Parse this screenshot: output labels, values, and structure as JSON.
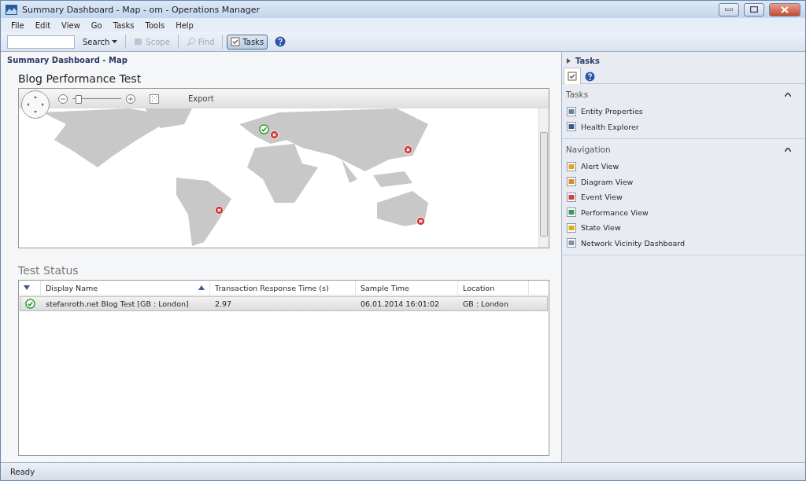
{
  "window": {
    "title": "Summary Dashboard - Map - om - Operations Manager"
  },
  "menu": [
    "File",
    "Edit",
    "View",
    "Go",
    "Tasks",
    "Tools",
    "Help"
  ],
  "toolbar": {
    "search_button": "Search",
    "scope": {
      "label": "Scope",
      "disabled": true
    },
    "find": {
      "label": "Find",
      "disabled": true
    },
    "tasks": {
      "label": "Tasks",
      "selected": true
    }
  },
  "breadcrumb": "Summary Dashboard - Map",
  "map_section": {
    "title": "Blog Performance Test",
    "zoom": {
      "level": 0.08
    },
    "export": "Export",
    "pins": [
      {
        "healthy": true
      },
      {
        "healthy": false
      },
      {
        "healthy": false
      },
      {
        "healthy": false
      },
      {
        "healthy": false
      }
    ]
  },
  "status_section": {
    "title": "Test Status",
    "columns": [
      {
        "label": "Display Name",
        "sorted": true
      },
      {
        "label": "Transaction Response Time (s)",
        "sorted": false
      },
      {
        "label": "Sample Time",
        "sorted": false
      },
      {
        "label": "Location",
        "sorted": false
      }
    ],
    "rows": [
      {
        "healthy": true,
        "selected": true,
        "cells": [
          "stefanroth.net Blog Test [GB : London]",
          "2.97",
          "06.01.2014 16:01:02",
          "GB : London"
        ]
      }
    ]
  },
  "tasks_pane": {
    "title": "Tasks",
    "tabs": [
      {
        "kind": "tasks",
        "selected": true
      },
      {
        "kind": "help",
        "selected": false
      }
    ],
    "sections": [
      {
        "title": "Tasks",
        "expanded": true,
        "items": [
          {
            "kind": "properties",
            "label": "Entity Properties"
          },
          {
            "kind": "health",
            "label": "Health Explorer"
          }
        ]
      },
      {
        "title": "Navigation",
        "expanded": true,
        "items": [
          {
            "kind": "alert",
            "label": "Alert View"
          },
          {
            "kind": "diagram",
            "label": "Diagram View"
          },
          {
            "kind": "event",
            "label": "Event View"
          },
          {
            "kind": "performance",
            "label": "Performance View"
          },
          {
            "kind": "state",
            "label": "State View"
          },
          {
            "kind": "network",
            "label": "Network Vicinity Dashboard"
          }
        ]
      }
    ]
  },
  "status_bar": "Ready"
}
